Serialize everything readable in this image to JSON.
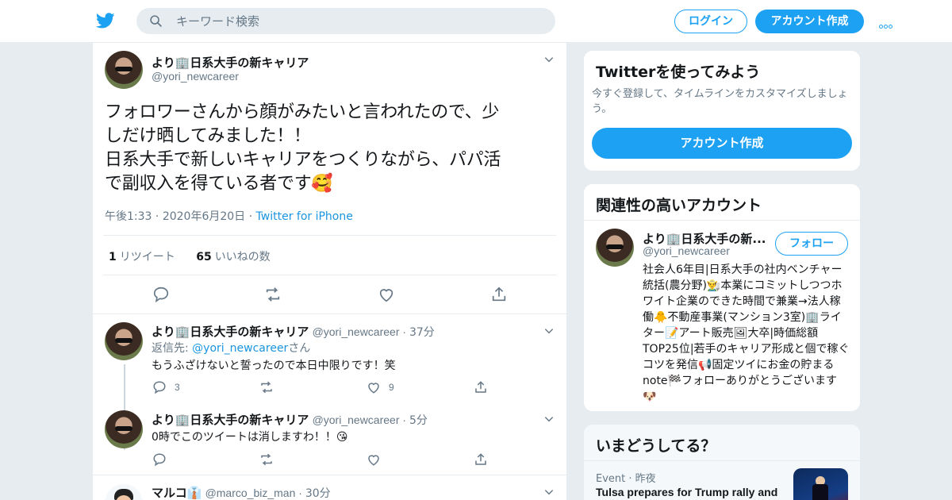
{
  "header": {
    "search_placeholder": "キーワード検索",
    "login_label": "ログイン",
    "signup_label": "アカウント作成",
    "brand_color": "#1da1f2"
  },
  "main_tweet": {
    "display_name": "より🏢日系大手の新キャリア",
    "handle": "@yori_newcareer",
    "text_lines": [
      "フォロワーさんから顔がみたいと言われたので、少",
      "しだけ晒してみました！！",
      "日系大手で新しいキャリアをつくりながら、パパ活",
      "で副収入を得ている者です🥰"
    ],
    "time": "午後1:33",
    "date": "2020年6月20日",
    "source": "Twitter for iPhone",
    "retweet_count": "1",
    "retweet_label": "リツイート",
    "like_count": "65",
    "like_label": "いいねの数"
  },
  "replies": [
    {
      "display_name": "より🏢日系大手の新キャリア",
      "handle": "@yori_newcareer",
      "time": "37分",
      "reply_to_prefix": "返信先: ",
      "reply_to_handle": "@yori_newcareer",
      "reply_to_suffix": "さん",
      "text": "もうふざけないと誓ったので本日中限りです！笑",
      "reply_count": "3",
      "like_count": "9"
    },
    {
      "display_name": "より🏢日系大手の新キャリア",
      "handle": "@yori_newcareer",
      "time": "5分",
      "text": "0時でこのツイートは消しますわ！！😘"
    },
    {
      "display_name": "マルコ👔",
      "handle": "@marco_biz_man",
      "time": "30分"
    }
  ],
  "sidebar": {
    "try_title": "Twitterを使ってみよう",
    "try_desc": "今すぐ登録して、タイムラインをカスタマイズしましょう。",
    "try_button": "アカウント作成",
    "related_title": "関連性の高いアカウント",
    "related_name": "より🏢日系大手の新...",
    "related_handle": "@yori_newcareer",
    "follow_label": "フォロー",
    "bio": "社会人6年目|日系大手の社内ベンチャー統括(農分野)👨‍🌾本業にコミットしつつホワイト企業のできた時間で兼業→法人稼働🐥不動産事業(マンション3室)🏢ライター📝アート販売🖼大卒|時価総額TOP25位|若手のキャリア形成と個で稼ぐコツを発信📢固定ツイにお金の貯まるnote🏁フォローありがとうございます🐶",
    "trends_title": "いまどうしてる？",
    "trend_category": "Event",
    "trend_time": "昨夜",
    "trend_headline": "Tulsa prepares for Trump rally and"
  }
}
